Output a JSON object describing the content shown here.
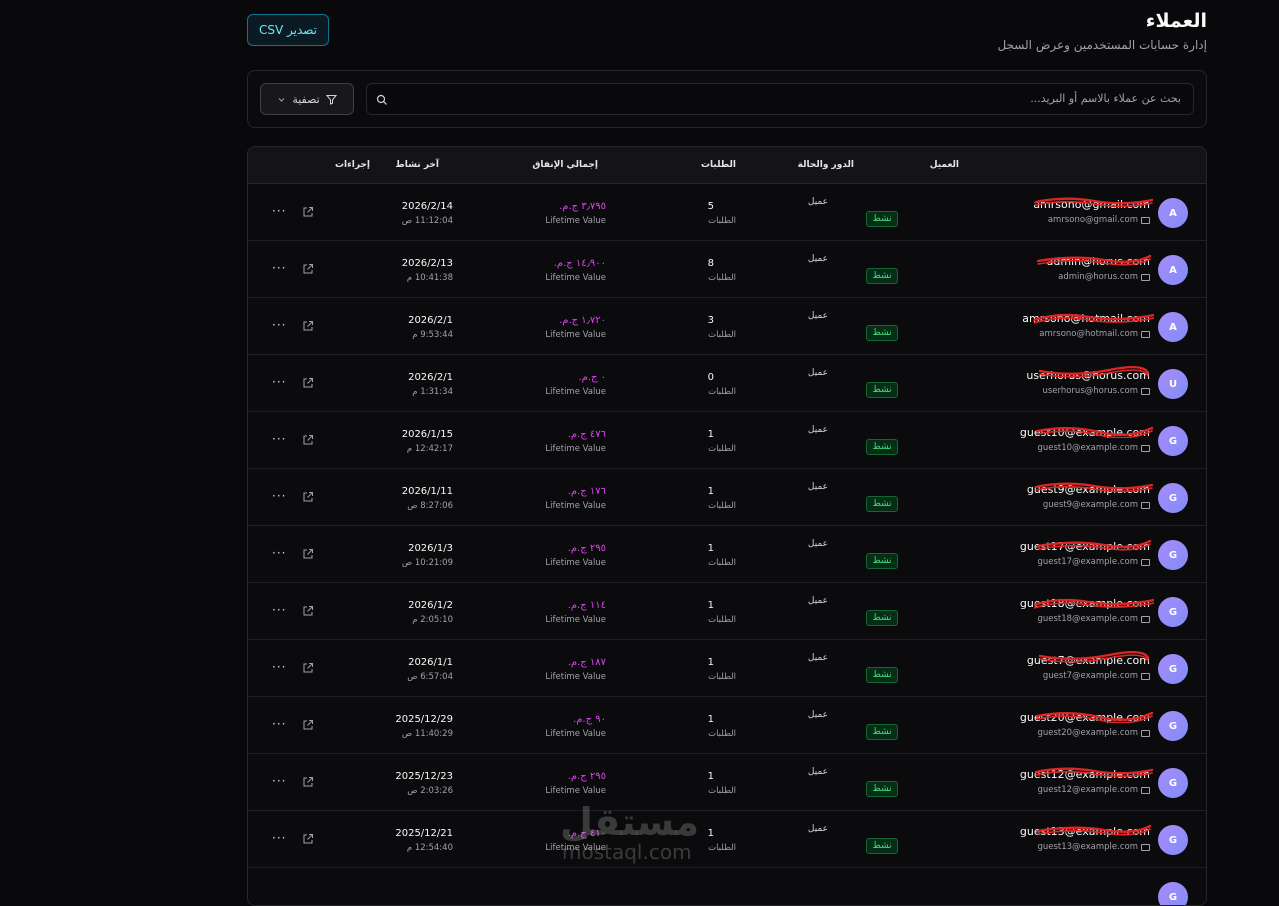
{
  "header": {
    "title": "العملاء",
    "subtitle": "إدارة حسابات المستخدمين وعرض السجل",
    "export_label": "تصدير CSV"
  },
  "search": {
    "placeholder": "بحث عن عملاء بالاسم أو البريد...",
    "filter_label": "تصفية"
  },
  "table": {
    "columns": {
      "customer": "العميل",
      "role_status": "الدور والحالة",
      "orders": "الطلبات",
      "spend": "إجمالي الإنفاق",
      "last_activity": "آخر نشاط",
      "actions": "إجراءات"
    },
    "orders_label": "الطلبات",
    "spend_label": "Lifetime Value",
    "role_label": "عميل",
    "status_label": "نشط",
    "rows": [
      {
        "initial": "A",
        "name": "amrsono@gmail.com",
        "email": "amrsono@gmail.com",
        "orders": "5",
        "spend": "٣٫٧٩٥ ج.م.‏",
        "date": "2026/2/14",
        "time": "11:12:04 ص"
      },
      {
        "initial": "A",
        "name": "admin@horus.com",
        "email": "admin@horus.com",
        "orders": "8",
        "spend": "١٤٫٩٠٠ ج.م.‏",
        "date": "2026/2/13",
        "time": "10:41:38 م"
      },
      {
        "initial": "A",
        "name": "amrsono@hotmail.com",
        "email": "amrsono@hotmail.com",
        "orders": "3",
        "spend": "١٫٧٢٠ ج.م.‏",
        "date": "2026/2/1",
        "time": "9:53:44 م"
      },
      {
        "initial": "U",
        "name": "userhorus@horus.com",
        "email": "userhorus@horus.com",
        "orders": "0",
        "spend": "٠ ج.م.‏",
        "date": "2026/2/1",
        "time": "1:31:34 م"
      },
      {
        "initial": "G",
        "name": "guest10@example.com",
        "email": "guest10@example.com",
        "orders": "1",
        "spend": "٤٧٦ ج.م.‏",
        "date": "2026/1/15",
        "time": "12:42:17 م"
      },
      {
        "initial": "G",
        "name": "guest9@example.com",
        "email": "guest9@example.com",
        "orders": "1",
        "spend": "١٧٦ ج.م.‏",
        "date": "2026/1/11",
        "time": "8:27:06 ص"
      },
      {
        "initial": "G",
        "name": "guest17@example.com",
        "email": "guest17@example.com",
        "orders": "1",
        "spend": "٢٩٥ ج.م.‏",
        "date": "2026/1/3",
        "time": "10:21:09 ص"
      },
      {
        "initial": "G",
        "name": "guest18@example.com",
        "email": "guest18@example.com",
        "orders": "1",
        "spend": "١١٤ ج.م.‏",
        "date": "2026/1/2",
        "time": "2:05:10 م"
      },
      {
        "initial": "G",
        "name": "guest7@example.com",
        "email": "guest7@example.com",
        "orders": "1",
        "spend": "١٨٧ ج.م.‏",
        "date": "2026/1/1",
        "time": "6:57:04 ص"
      },
      {
        "initial": "G",
        "name": "guest20@example.com",
        "email": "guest20@example.com",
        "orders": "1",
        "spend": "٩٠ ج.م.‏",
        "date": "2025/12/29",
        "time": "11:40:29 ص"
      },
      {
        "initial": "G",
        "name": "guest12@example.com",
        "email": "guest12@example.com",
        "orders": "1",
        "spend": "٢٩٥ ج.م.‏",
        "date": "2025/12/23",
        "time": "2:03:26 ص"
      },
      {
        "initial": "G",
        "name": "guest13@example.com",
        "email": "guest13@example.com",
        "orders": "1",
        "spend": "٤١٠ ج.م.‏",
        "date": "2025/12/21",
        "time": "12:54:40 م"
      },
      {
        "initial": "G",
        "name": "",
        "email": "",
        "orders": "",
        "spend": "",
        "date": "",
        "time": ""
      }
    ]
  },
  "watermark": {
    "arabic": "مستقل",
    "latin": "mostaql.com"
  },
  "colors": {
    "background": "#09090b",
    "accent": "#67e8f9",
    "spend": "#d946ef",
    "status": "#4ade80",
    "scribble": "#dc2626"
  }
}
